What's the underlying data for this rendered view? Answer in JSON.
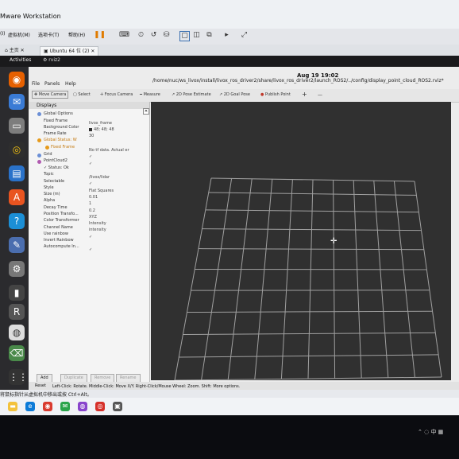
{
  "vmware": {
    "title": "Mware Workstation",
    "menus": [
      "(I)",
      "虚拟机(M)",
      "选项卡(T)",
      "帮助(H)"
    ],
    "tabs": [
      "主页",
      "Ubuntu 64 位 (2)"
    ]
  },
  "ubuntu": {
    "activities": "Activities",
    "app_name": "rviz2",
    "clock": "Aug 19 19:02"
  },
  "rviz": {
    "path": "/home/nuc/ws_livox/install/livox_ros_driver2/share/livox_ros_driver2/launch_ROS2/../config/display_point_cloud_ROS2.rviz*",
    "menus": [
      "File",
      "Panels",
      "Help"
    ],
    "tools": [
      "Move Camera",
      "Select",
      "Focus Camera",
      "Measure",
      "2D Pose Estimate",
      "2D Goal Pose",
      "Publish Point"
    ],
    "tool_extras": [
      "+",
      "—"
    ],
    "displays_title": "Displays",
    "tree": [
      {
        "label": "Global Options",
        "value": ""
      },
      {
        "label": "Fixed Frame",
        "value": "livox_frame"
      },
      {
        "label": "Background Color",
        "value": "48; 48; 48"
      },
      {
        "label": "Frame Rate",
        "value": "30"
      },
      {
        "label": "Global Status: W",
        "value": ""
      },
      {
        "label": "Fixed Frame",
        "value": "No tf data.  Actual er"
      },
      {
        "label": "Grid",
        "value": "✓"
      },
      {
        "label": "PointCloud2",
        "value": "✓"
      },
      {
        "label": "✓  Status: Ok",
        "value": ""
      },
      {
        "label": "Topic",
        "value": "/livox/lidar"
      },
      {
        "label": "Selectable",
        "value": "✓"
      },
      {
        "label": "Style",
        "value": "Flat Squares"
      },
      {
        "label": "Size (m)",
        "value": "0.01"
      },
      {
        "label": "Alpha",
        "value": "1"
      },
      {
        "label": "Decay Time",
        "value": "0.2"
      },
      {
        "label": "Position Transfo...",
        "value": "XYZ"
      },
      {
        "label": "Color Transformer",
        "value": "Intensity"
      },
      {
        "label": "Channel Name",
        "value": "intensity"
      },
      {
        "label": "Use rainbow",
        "value": "✓"
      },
      {
        "label": "Invert Rainbow",
        "value": ""
      },
      {
        "label": "Autocompute In...",
        "value": "✓"
      }
    ],
    "buttons": [
      "Add",
      "Duplicate",
      "Remove",
      "Rename"
    ],
    "reset": "Reset",
    "status": "Left-Click: Rotate.  Middle-Click: Move X/Y.  Right-Click/Mouse Wheel: Zoom.  Shift: More options."
  },
  "windows": {
    "hint": "要将输入定向到该虚拟机，请将鼠标指针移入其中或按 Ctrl+G。",
    "hint_short": "将鼠标指针从虚拟机中移出或按 Ctrl+Alt。",
    "tray_lang": "中"
  },
  "colors": {
    "viewport_bg": "#303030",
    "grid_line": "#a0a0a0",
    "accent_ubuntu": "#e95420"
  }
}
